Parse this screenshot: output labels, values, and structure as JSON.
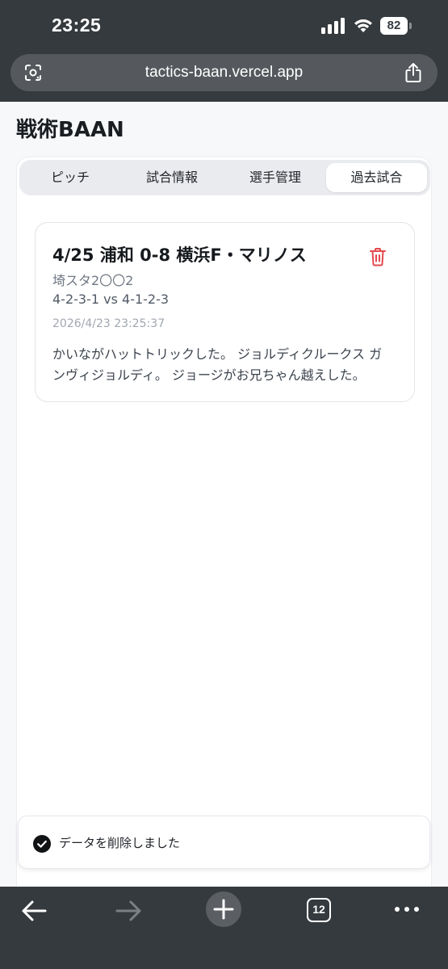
{
  "status_bar": {
    "time": "23:25",
    "battery": "82"
  },
  "browser": {
    "url": "tactics-baan.vercel.app",
    "tabs_count": "12"
  },
  "app": {
    "title": "戦術BAAN"
  },
  "tabs": [
    {
      "label": "ピッチ",
      "active": false
    },
    {
      "label": "試合情報",
      "active": false
    },
    {
      "label": "選手管理",
      "active": false
    },
    {
      "label": "過去試合",
      "active": true
    }
  ],
  "match": {
    "title": "4/25 浦和 0-8 横浜F・マリノス",
    "venue": "埼スタ2〇〇2",
    "formation": "4-2-3-1 vs 4-1-2-3",
    "saved_at": "2026/4/23 23:25:37",
    "notes": "かいながハットトリックした。 ジョルディクルークス ガンヴィジョルディ。 ジョージがお兄ちゃん越えした。"
  },
  "toast": {
    "message": "データを削除しました"
  },
  "colors": {
    "chrome": "#353a3e",
    "delete": "#e5484d",
    "accent_text": "#16191d"
  }
}
